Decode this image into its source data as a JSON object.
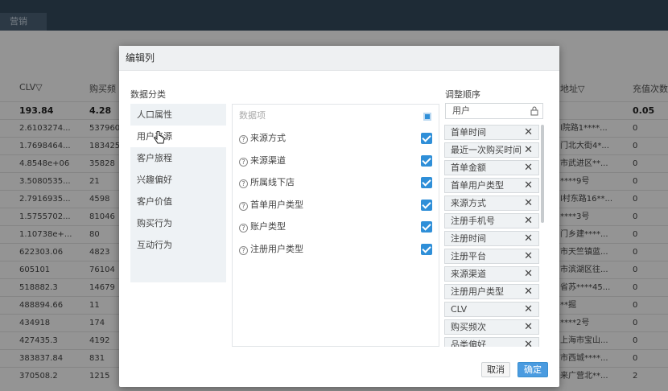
{
  "topbar": {
    "tab_label": "营销"
  },
  "table": {
    "headers": [
      "CLV▽",
      "购买频",
      "地址▽",
      "充值次数"
    ],
    "summary": [
      "193.84",
      "4.28",
      "",
      "0.05"
    ],
    "rows": [
      [
        "2.6103274...",
        "537960",
        "l院路1****...",
        "0"
      ],
      [
        "1.7698464...",
        "183425",
        "门北大街4*...",
        "0"
      ],
      [
        "4.8548e+06",
        "35828",
        "市武进区**...",
        "0"
      ],
      [
        "3.5080535...",
        "21",
        "****9号",
        "0"
      ],
      [
        "2.7916935...",
        "4598",
        "l村东路16**...",
        "0"
      ],
      [
        "1.5755702...",
        "81046",
        "****3号",
        "0"
      ],
      [
        "1.10738e+...",
        "80",
        "门乡建****...",
        "0"
      ],
      [
        "622303.06",
        "4823",
        "市天竺镇蓝...",
        "0"
      ],
      [
        "605101",
        "76104",
        "市滨湖区往...",
        "0"
      ],
      [
        "518882.3",
        "14679",
        "省苏****45...",
        "0"
      ],
      [
        "488894.66",
        "11",
        "**掘",
        "0"
      ],
      [
        "434918",
        "174",
        "****2号",
        "0"
      ],
      [
        "427435.3",
        "4192",
        "上海市宝山...",
        "0"
      ],
      [
        "383837.84",
        "831",
        "市西城****...",
        "0"
      ],
      [
        "370508.2",
        "1215",
        "来广营北**...",
        "2"
      ]
    ]
  },
  "dialog": {
    "title": "编辑列",
    "category_label": "数据分类",
    "order_label": "调整顺序",
    "categories": [
      "人口属性",
      "用户来源",
      "客户旅程",
      "兴趣偏好",
      "客户价值",
      "购买行为",
      "互动行为"
    ],
    "data_head": "数据项",
    "data_items": [
      "来源方式",
      "来源渠道",
      "所属线下店",
      "首单用户类型",
      "账户类型",
      "注册用户类型"
    ],
    "qmark": "?",
    "fixed_item": "用户",
    "order_items": [
      "首单时间",
      "最近一次购买时间",
      "首单金额",
      "首单用户类型",
      "来源方式",
      "注册手机号",
      "注册时间",
      "注册平台",
      "来源渠道",
      "注册用户类型",
      "CLV",
      "购买频次",
      "品类偏好"
    ],
    "remove_glyph": "✕",
    "cancel_label": "取消",
    "ok_label": "确定"
  },
  "colors": {
    "accent": "#2f8fd8",
    "topbar": "#344a5e",
    "overlay": "rgba(0,0,0,0.42)"
  },
  "icons": [
    "lock-icon",
    "close-icon",
    "question-icon",
    "checkbox-icon",
    "hand-cursor-icon"
  ]
}
